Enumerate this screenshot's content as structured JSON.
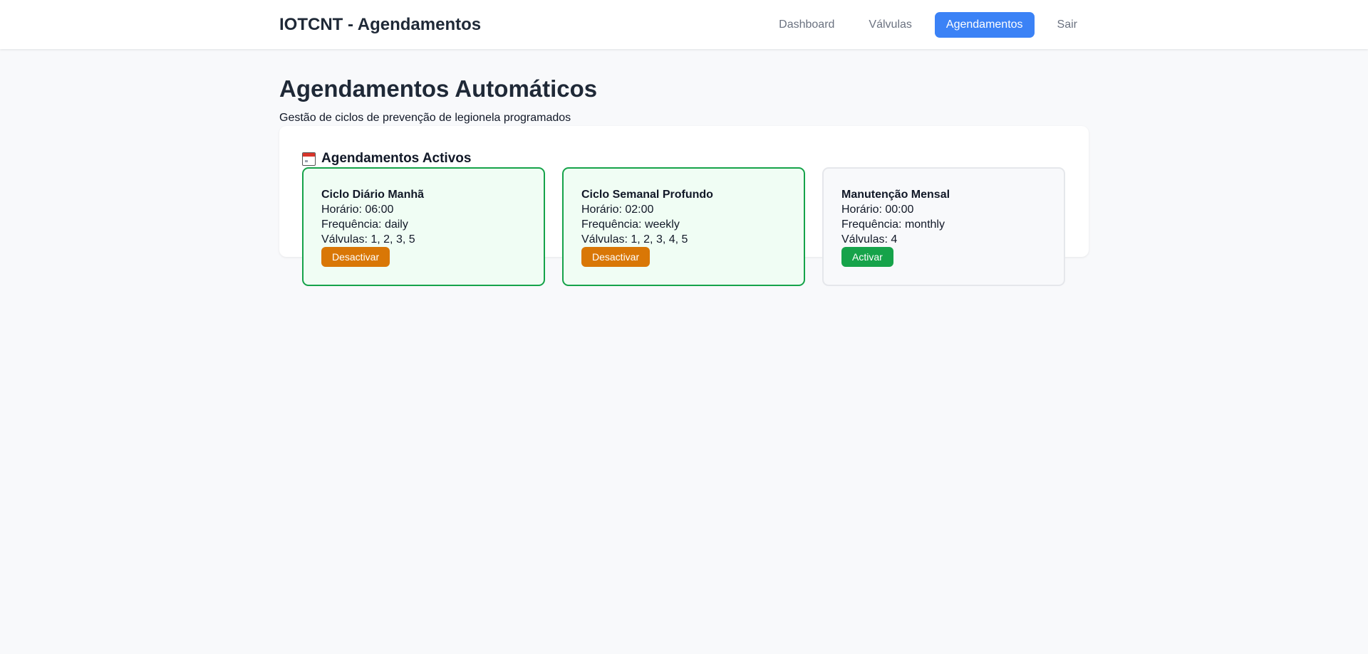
{
  "app": {
    "title": "IOTCNT - Agendamentos"
  },
  "nav": {
    "items": [
      {
        "label": "Dashboard",
        "active": false
      },
      {
        "label": "Válvulas",
        "active": false
      },
      {
        "label": "Agendamentos",
        "active": true
      },
      {
        "label": "Sair",
        "active": false
      }
    ]
  },
  "page": {
    "title": "Agendamentos Automáticos",
    "subtitle": "Gestão de ciclos de prevenção de legionela programados"
  },
  "panel": {
    "icon": "calendar-icon",
    "title": "Agendamentos Activos"
  },
  "schedules": [
    {
      "name": "Ciclo Diário Manhã",
      "time_label": "Horário: 06:00",
      "freq_label": "Frequência: daily",
      "valves_label": "Válvulas: 1, 2, 3, 5",
      "button_label": "Desactivar",
      "active": true
    },
    {
      "name": "Ciclo Semanal Profundo",
      "time_label": "Horário: 02:00",
      "freq_label": "Frequência: weekly",
      "valves_label": "Válvulas: 1, 2, 3, 4, 5",
      "button_label": "Desactivar",
      "active": true
    },
    {
      "name": "Manutenção Mensal",
      "time_label": "Horário: 00:00",
      "freq_label": "Frequência: monthly",
      "valves_label": "Válvulas: 4",
      "button_label": "Activar",
      "active": false
    }
  ],
  "colors": {
    "accent": "#3b82f6",
    "active_border": "#16a34a",
    "active_bg": "#f0fdf4",
    "deactivate_button": "#d97706",
    "activate_button": "#16a34a"
  }
}
